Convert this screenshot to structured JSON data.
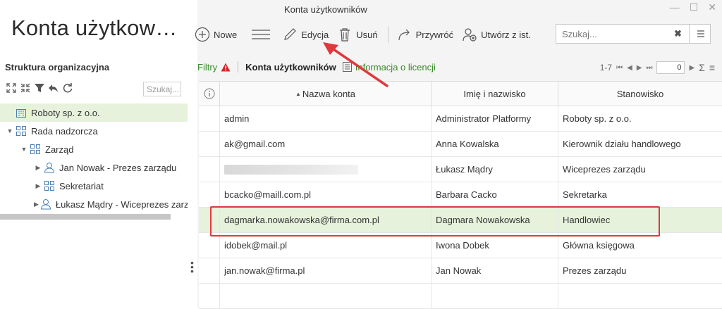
{
  "app_title": "Konta użytkow…",
  "left": {
    "section_title": "Struktura organizacyjna",
    "search_placeholder": "Szukaj...",
    "tree": [
      {
        "label": "Roboty sp. z o.o.",
        "level": 0,
        "toggle": "",
        "icon": "building-icon",
        "selected": true
      },
      {
        "label": "Rada nadzorcza",
        "level": 0,
        "toggle": "▼",
        "icon": "org-unit-icon",
        "selected": false
      },
      {
        "label": "Zarząd",
        "level": 1,
        "toggle": "▼",
        "icon": "org-unit-icon",
        "selected": false
      },
      {
        "label": "Jan Nowak - Prezes zarządu",
        "level": 2,
        "toggle": "▶",
        "icon": "user-icon",
        "selected": false
      },
      {
        "label": "Sekretariat",
        "level": 2,
        "toggle": "▶",
        "icon": "org-unit-icon",
        "selected": false
      },
      {
        "label": "Łukasz Mądry - Wiceprezes zarz",
        "level": 2,
        "toggle": "▶",
        "icon": "user-icon",
        "selected": false
      }
    ]
  },
  "window": {
    "title": "Konta użytkowników",
    "controls": [
      "—",
      "☐",
      "✕"
    ]
  },
  "toolbar": {
    "new_label": "Nowe",
    "edit_label": "Edycja",
    "delete_label": "Usuń",
    "restore_label": "Przywróć",
    "create_from_label": "Utwórz z ist.",
    "search_placeholder": "Szukaj..."
  },
  "tabs": {
    "filters_label": "Filtry",
    "accounts_label": "Konta użytkowników",
    "license_label": "Informacja o licencji"
  },
  "pager": {
    "range": "1-7",
    "page_value": "0"
  },
  "grid": {
    "columns": [
      "Nazwa konta",
      "Imię i nazwisko",
      "Stanowisko"
    ],
    "rows": [
      {
        "account": "admin",
        "name": "Administrator Platformy",
        "position": "Roboty sp. z o.o.",
        "blurred": false,
        "selected": false
      },
      {
        "account": "ak@gmail.com",
        "name": "Anna Kowalska",
        "position": "Kierownik działu handlowego",
        "blurred": false,
        "selected": false
      },
      {
        "account": "",
        "name": "Łukasz Mądry",
        "position": "Wiceprezes zarządu",
        "blurred": true,
        "selected": false
      },
      {
        "account": "bcacko@maill.com.pl",
        "name": "Barbara Cacko",
        "position": "Sekretarka",
        "blurred": false,
        "selected": false
      },
      {
        "account": "dagmarka.nowakowska@firma.com.pl",
        "name": "Dagmara Nowakowska",
        "position": "Handlowiec",
        "blurred": false,
        "selected": true
      },
      {
        "account": "idobek@mail.pl",
        "name": "Iwona Dobek",
        "position": "Główna księgowa",
        "blurred": false,
        "selected": false
      },
      {
        "account": "jan.nowak@firma.pl",
        "name": "Jan Nowak",
        "position": "Prezes zarządu",
        "blurred": false,
        "selected": false
      }
    ]
  },
  "colors": {
    "accent_green": "#3a8a2a",
    "selection": "#e6f2dc",
    "annotation_red": "#e0383d"
  }
}
